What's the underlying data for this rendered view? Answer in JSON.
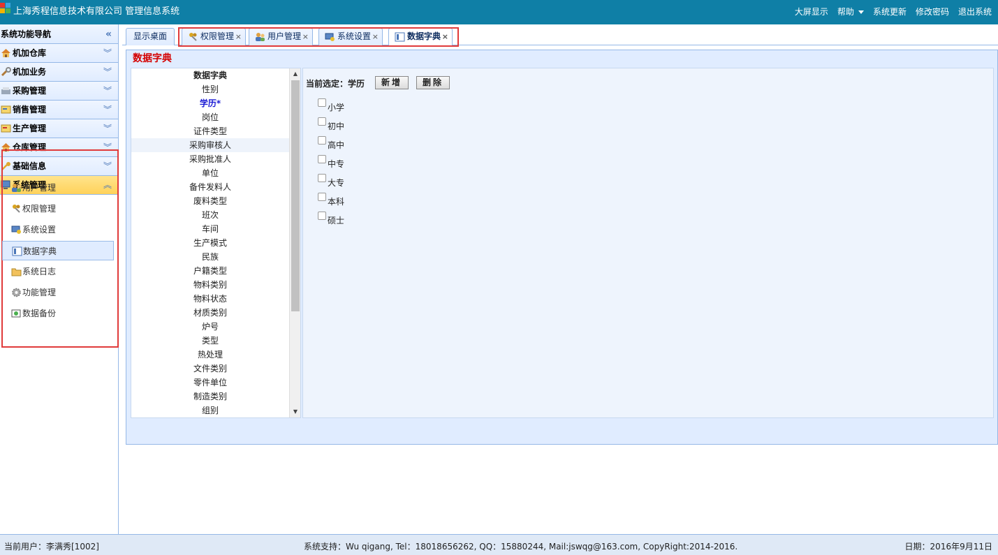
{
  "header": {
    "app_title": "上海秀程信息技术有限公司 管理信息系统",
    "menu": [
      "大屏显示",
      "帮助",
      "系统更新",
      "修改密码",
      "退出系统"
    ]
  },
  "sidebar": {
    "title": "系统功能导航",
    "sections": [
      {
        "label": "机加仓库",
        "icon": "warehouse-icon"
      },
      {
        "label": "机加业务",
        "icon": "wrench-icon"
      },
      {
        "label": "采购管理",
        "icon": "purchase-icon"
      },
      {
        "label": "销售管理",
        "icon": "sales-icon"
      },
      {
        "label": "生产管理",
        "icon": "production-icon"
      },
      {
        "label": "仓库管理",
        "icon": "warehouse-icon"
      },
      {
        "label": "基础信息",
        "icon": "key-icon"
      },
      {
        "label": "系统管理",
        "icon": "computer-icon"
      }
    ],
    "system_items": [
      {
        "label": "用户管理",
        "icon": "users-icon"
      },
      {
        "label": "权限管理",
        "icon": "keys-icon"
      },
      {
        "label": "系统设置",
        "icon": "settings-icon"
      },
      {
        "label": "数据字典",
        "icon": "dictionary-icon"
      },
      {
        "label": "系统日志",
        "icon": "log-folder-icon"
      },
      {
        "label": "功能管理",
        "icon": "gear-icon"
      },
      {
        "label": "数据备份",
        "icon": "backup-icon"
      }
    ]
  },
  "tabs": {
    "desktop": "显示桌面",
    "items": [
      {
        "label": "权限管理",
        "icon": "keys-icon"
      },
      {
        "label": "用户管理",
        "icon": "users-icon"
      },
      {
        "label": "系统设置",
        "icon": "settings-icon"
      },
      {
        "label": "数据字典",
        "icon": "dictionary-icon"
      }
    ],
    "close": "×"
  },
  "panel": {
    "title": "数据字典",
    "dict_header": "数据字典",
    "dict_items": [
      "性别",
      "学历*",
      "岗位",
      "证件类型",
      "采购审核人",
      "采购批准人",
      "单位",
      "备件发料人",
      "废料类型",
      "班次",
      "车间",
      "生产模式",
      "民族",
      "户籍类型",
      "物料类别",
      "物料状态",
      "材质类别",
      "炉号",
      "类型",
      "热处理",
      "文件类别",
      "零件单位",
      "制造类别",
      "组别"
    ],
    "current_selection": "当前选定：学历",
    "add_button": "新增",
    "delete_button": "删除",
    "options": [
      "小学",
      "初中",
      "高中",
      "中专",
      "大专",
      "本科",
      "硕士"
    ]
  },
  "footer": {
    "user": "当前用户：李满秀[1002]",
    "support": "系统支持：Wu qigang, Tel：18018656262, QQ：15880244, Mail:jswqg@163.com, CopyRight:2014-2016.",
    "date": "日期：2016年9月11日"
  },
  "colors": {
    "header_bg": "#0f7fa6",
    "accent_red": "#d40000",
    "highlight_border": "#e03a3a",
    "selected_item": "#1a1ad4"
  }
}
